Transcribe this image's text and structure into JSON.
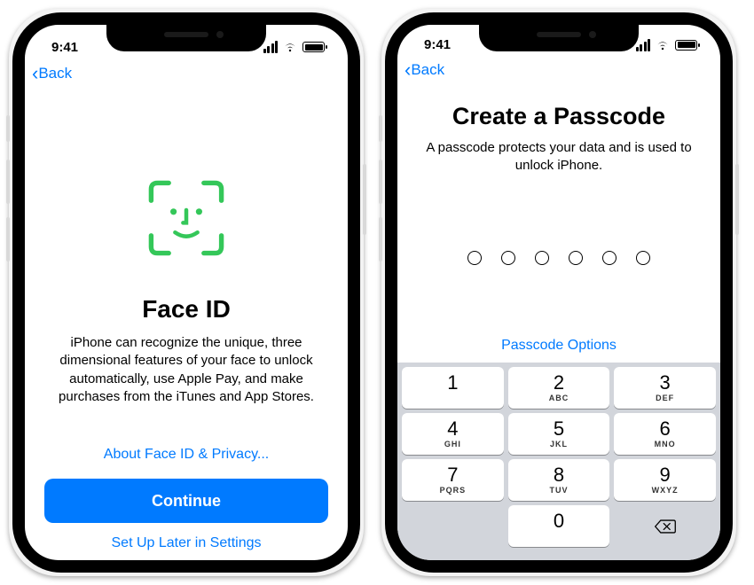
{
  "status": {
    "time": "9:41"
  },
  "nav": {
    "back": "Back"
  },
  "faceid": {
    "title": "Face ID",
    "desc": "iPhone can recognize the unique, three dimensional features of your face to unlock automatically, use Apple Pay, and make purchases from the iTunes and App Stores.",
    "about": "About Face ID & Privacy...",
    "continue": "Continue",
    "later": "Set Up Later in Settings"
  },
  "passcode": {
    "title": "Create a Passcode",
    "desc": "A passcode protects your data and is used to unlock iPhone.",
    "options": "Passcode Options",
    "keys": {
      "k1": "1",
      "l1": "",
      "k2": "2",
      "l2": "ABC",
      "k3": "3",
      "l3": "DEF",
      "k4": "4",
      "l4": "GHI",
      "k5": "5",
      "l5": "JKL",
      "k6": "6",
      "l6": "MNO",
      "k7": "7",
      "l7": "PQRS",
      "k8": "8",
      "l8": "TUV",
      "k9": "9",
      "l9": "WXYZ",
      "k0": "0",
      "l0": ""
    }
  }
}
